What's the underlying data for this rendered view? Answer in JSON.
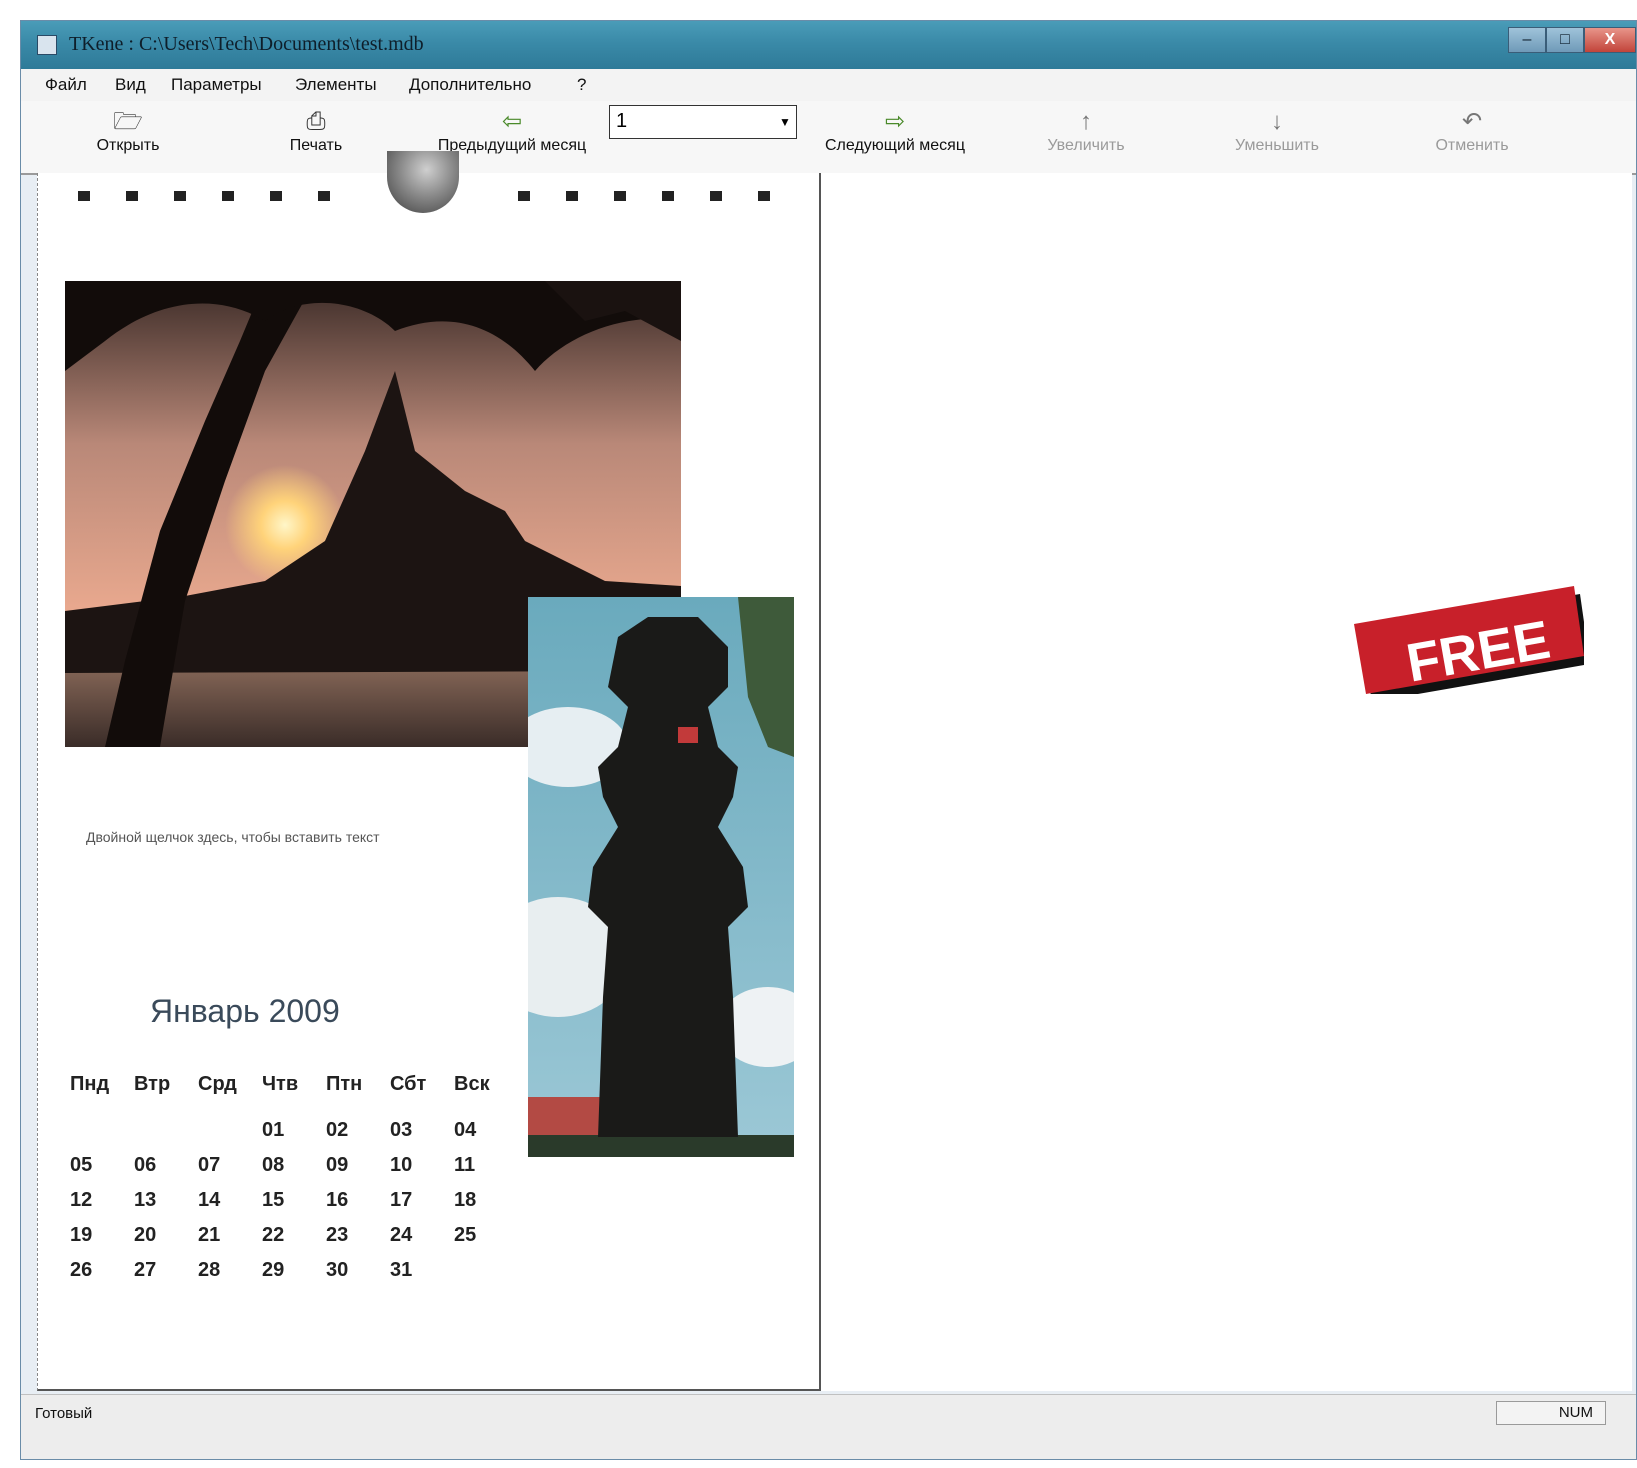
{
  "window": {
    "title": "TKene : C:\\Users\\Tech\\Documents\\test.mdb",
    "buttons": {
      "minimize": "–",
      "maximize": "□",
      "close": "X"
    }
  },
  "menu": [
    "Файл",
    "Вид",
    "Параметры",
    "Элементы",
    "Дополнительно",
    "?"
  ],
  "toolbar": {
    "open": "Открыть",
    "print": "Печать",
    "prev_month": "Предыдущий месяц",
    "month_select": "1",
    "next_month": "Следующий месяц",
    "zoom_in": "Увеличить",
    "zoom_out": "Уменьшить",
    "undo": "Отменить"
  },
  "page": {
    "caption": "Двойной щелчок здесь, чтобы вставить текст",
    "month_title": "Январь 2009",
    "weekdays": [
      "Пнд",
      "Втр",
      "Срд",
      "Чтв",
      "Птн",
      "Сбт",
      "Вск"
    ],
    "weeks": [
      [
        "",
        "",
        "",
        "01",
        "02",
        "03",
        "04"
      ],
      [
        "05",
        "06",
        "07",
        "08",
        "09",
        "10",
        "11"
      ],
      [
        "12",
        "13",
        "14",
        "15",
        "16",
        "17",
        "18"
      ],
      [
        "19",
        "20",
        "21",
        "22",
        "23",
        "24",
        "25"
      ],
      [
        "26",
        "27",
        "28",
        "29",
        "30",
        "31",
        ""
      ]
    ]
  },
  "badge": {
    "text": "FREE",
    "color": "#c8202a"
  },
  "status": {
    "left": "Готовый",
    "right": "NUM"
  }
}
